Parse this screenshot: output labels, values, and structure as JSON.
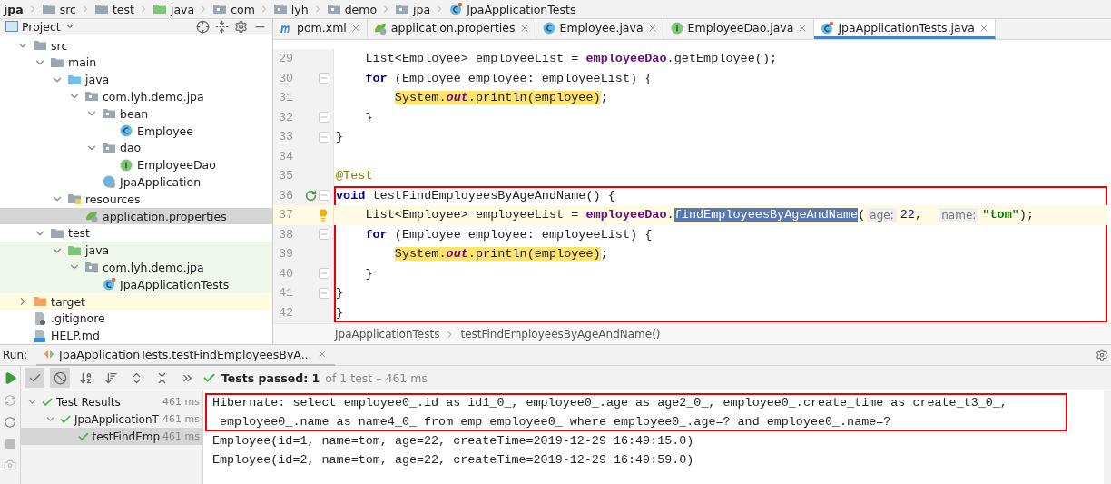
{
  "navbar": {
    "crumbs": [
      {
        "label": "jpa",
        "kind": "project"
      },
      {
        "label": "src",
        "kind": "folder"
      },
      {
        "label": "test",
        "kind": "folder"
      },
      {
        "label": "java",
        "kind": "test-source"
      },
      {
        "label": "com",
        "kind": "package"
      },
      {
        "label": "lyh",
        "kind": "package"
      },
      {
        "label": "demo",
        "kind": "package"
      },
      {
        "label": "jpa",
        "kind": "package"
      },
      {
        "label": "JpaApplicationTests",
        "kind": "test-class"
      }
    ]
  },
  "project_panel": {
    "title": "Project",
    "tree": [
      {
        "label": "src",
        "kind": "folder",
        "expanded": true,
        "selected": false,
        "children": [
          {
            "label": "main",
            "kind": "folder",
            "expanded": true,
            "selected": false,
            "children": [
              {
                "label": "java",
                "kind": "source",
                "expanded": true,
                "selected": false,
                "children": [
                  {
                    "label": "com.lyh.demo.jpa",
                    "kind": "package",
                    "expanded": true,
                    "selected": false,
                    "children": [
                      {
                        "label": "bean",
                        "kind": "package",
                        "expanded": true,
                        "selected": false,
                        "children": [
                          {
                            "label": "Employee",
                            "kind": "class",
                            "selected": false
                          }
                        ]
                      },
                      {
                        "label": "dao",
                        "kind": "package",
                        "expanded": true,
                        "selected": false,
                        "children": [
                          {
                            "label": "EmployeeDao",
                            "kind": "interface",
                            "selected": false
                          }
                        ]
                      },
                      {
                        "label": "JpaApplication",
                        "kind": "spring-class",
                        "selected": false
                      }
                    ]
                  }
                ]
              },
              {
                "label": "resources",
                "kind": "resources",
                "expanded": true,
                "selected": false,
                "children": [
                  {
                    "label": "application.properties",
                    "kind": "properties",
                    "selected": true
                  }
                ]
              }
            ]
          },
          {
            "label": "test",
            "kind": "folder",
            "expanded": true,
            "selected": false,
            "children": [
              {
                "label": "java",
                "kind": "test-source",
                "expanded": true,
                "selected": false,
                "children": [
                  {
                    "label": "com.lyh.demo.jpa",
                    "kind": "package",
                    "expanded": true,
                    "selected": false,
                    "children": [
                      {
                        "label": "JpaApplicationTests",
                        "kind": "test-class",
                        "selected": false
                      }
                    ]
                  }
                ]
              }
            ]
          }
        ]
      },
      {
        "label": "target",
        "kind": "excluded",
        "expanded": false,
        "selected": false
      },
      {
        "label": ".gitignore",
        "kind": "file",
        "selected": false
      },
      {
        "label": "HELP.md",
        "kind": "markdown",
        "selected": false
      }
    ]
  },
  "editor": {
    "tabs": [
      {
        "label": "pom.xml",
        "kind": "pom",
        "selected": false
      },
      {
        "label": "application.properties",
        "kind": "properties",
        "selected": false
      },
      {
        "label": "Employee.java",
        "kind": "class",
        "selected": false
      },
      {
        "label": "EmployeeDao.java",
        "kind": "interface",
        "selected": false
      },
      {
        "label": "JpaApplicationTests.java",
        "kind": "test-class",
        "selected": true
      }
    ],
    "blocks": [
      {
        "framed": false,
        "lines": [
          {
            "number": "29",
            "current": false,
            "kind": "plain",
            "tokens": [
              {
                "text": "    List<Employee> employeeList = ",
                "kind": "plain"
              },
              {
                "text": "employeeDao",
                "kind": "field"
              },
              {
                "text": ".getEmployee();",
                "kind": "plain"
              }
            ]
          },
          {
            "number": "30",
            "current": false,
            "kind": "fold",
            "tokens": [
              {
                "text": "    for",
                "kind": "keyword"
              },
              {
                "text": " (Employee employee: employeeList) {",
                "kind": "plain"
              }
            ]
          },
          {
            "number": "31",
            "current": false,
            "kind": "plain",
            "tokens": [
              {
                "text": "        System.",
                "kind": "hl-plain"
              },
              {
                "text": "out",
                "kind": "hl-static"
              },
              {
                "text": ".println(employee)",
                "kind": "hl-plain"
              },
              {
                "text": ";",
                "kind": "plain"
              }
            ]
          },
          {
            "number": "32",
            "current": false,
            "kind": "fold",
            "tokens": [
              {
                "text": "    }",
                "kind": "plain"
              }
            ]
          },
          {
            "number": "33",
            "current": false,
            "kind": "fold",
            "tokens": [
              {
                "text": "}",
                "kind": "plain"
              }
            ]
          },
          {
            "number": "34",
            "current": false,
            "kind": "plain"
          },
          {
            "number": "35",
            "current": false,
            "kind": "plain",
            "tokens": [
              {
                "text": "@Test",
                "kind": "annotation"
              }
            ]
          }
        ]
      },
      {
        "framed": true,
        "lines": [
          {
            "number": "36",
            "current": false,
            "kind": "run",
            "tokens": [
              {
                "text": "void",
                "kind": "keyword"
              },
              {
                "text": " testFindEmployeesByAgeAndName() {",
                "kind": "plain"
              }
            ]
          },
          {
            "number": "37",
            "current": true,
            "kind": "bulb",
            "tokens": [
              {
                "text": "    List<Employee> employeeList = ",
                "kind": "plain"
              },
              {
                "text": "employeeDao",
                "kind": "field"
              },
              {
                "text": ".",
                "kind": "plain"
              },
              {
                "text": "findEmployeesByAgeAndName",
                "kind": "selection"
              },
              {
                "text": "(",
                "kind": "plain"
              },
              {
                "text": "age:",
                "kind": "hint"
              },
              {
                "text": "22",
                "kind": "number"
              },
              {
                "text": ",  ",
                "kind": "plain"
              },
              {
                "text": "name:",
                "kind": "hint"
              },
              {
                "text": "\"tom\"",
                "kind": "string"
              },
              {
                "text": ");",
                "kind": "plain"
              }
            ]
          },
          {
            "number": "38",
            "current": false,
            "kind": "fold",
            "tokens": [
              {
                "text": "    for",
                "kind": "keyword"
              },
              {
                "text": " (Employee employee: employeeList) {",
                "kind": "plain"
              }
            ]
          },
          {
            "number": "39",
            "current": false,
            "kind": "plain",
            "tokens": [
              {
                "text": "        System.",
                "kind": "hl-plain"
              },
              {
                "text": "out",
                "kind": "hl-static"
              },
              {
                "text": ".println(employee)",
                "kind": "hl-plain"
              },
              {
                "text": ";",
                "kind": "plain"
              }
            ]
          },
          {
            "number": "40",
            "current": false,
            "kind": "fold",
            "tokens": [
              {
                "text": "    }",
                "kind": "plain"
              }
            ]
          },
          {
            "number": "41",
            "current": false,
            "kind": "fold",
            "tokens": [
              {
                "text": "}",
                "kind": "plain"
              }
            ]
          },
          {
            "number": "42",
            "current": false,
            "kind": "plain",
            "tokens": [
              {
                "text": "}",
                "kind": "plain"
              }
            ]
          }
        ]
      }
    ],
    "breadcrumb": [
      "JpaApplicationTests",
      "testFindEmployeesByAgeAndName()"
    ]
  },
  "run_panel": {
    "label": "Run:",
    "tab": "JpaApplicationTests.testFindEmployeesByA...",
    "toolbar": [
      {
        "kind": "show-passed",
        "selected": true
      },
      {
        "kind": "show-ignored",
        "selected": true
      },
      {
        "kind": "sort-alpha",
        "selected": false
      },
      {
        "kind": "sort-duration",
        "selected": false
      },
      {
        "kind": "expand-all",
        "selected": false
      },
      {
        "kind": "collapse-all",
        "selected": false
      },
      {
        "kind": "more",
        "selected": false
      }
    ],
    "status": {
      "passed": "Tests passed: 1",
      "detail": "of 1 test – 461 ms"
    },
    "results": [
      {
        "label": "Test Results",
        "time": "461 ms",
        "selected": false,
        "children": [
          {
            "label": "JpaApplicationT",
            "time": "461 ms",
            "selected": false,
            "children": [
              {
                "label": "testFindEmp",
                "time": "461 ms",
                "selected": true
              }
            ]
          }
        ]
      }
    ],
    "console": [
      {
        "framed": true,
        "lines": [
          "Hibernate: select employee0_.id as id1_0_, employee0_.age as age2_0_, employee0_.create_time as create_t3_0_,",
          " employee0_.name as name4_0_ from emp employee0_ where employee0_.age=? and employee0_.name=?"
        ]
      },
      {
        "framed": false,
        "lines": [
          "Employee(id=1, name=tom, age=22, createTime=2019-12-29 16:49:15.0)",
          "Employee(id=2, name=tom, age=22, createTime=2019-12-29 16:49:59.0)"
        ]
      }
    ]
  }
}
